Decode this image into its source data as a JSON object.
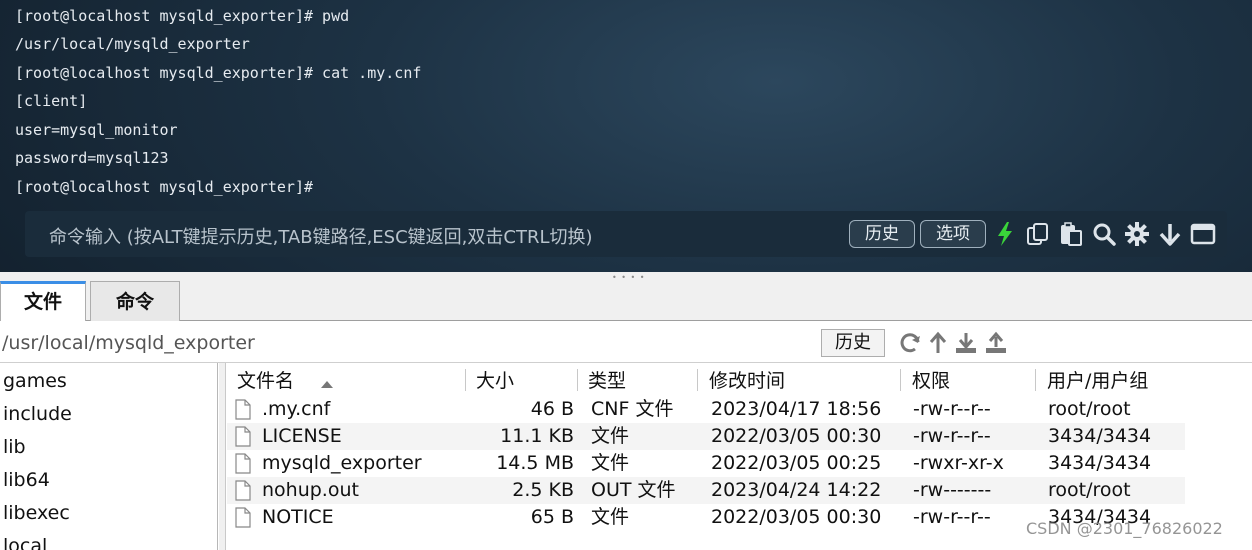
{
  "terminal": {
    "lines": [
      "[root@localhost mysqld_exporter]# pwd",
      "/usr/local/mysqld_exporter",
      "[root@localhost mysqld_exporter]# cat .my.cnf",
      "[client]",
      "user=mysql_monitor",
      "password=mysql123",
      "[root@localhost mysqld_exporter]#"
    ],
    "command_placeholder": "命令输入 (按ALT键提示历史,TAB键路径,ESC键返回,双击CTRL切换)",
    "history_button": "历史",
    "options_button": "选项",
    "toolbar_icons": [
      "lightning-icon",
      "copy-icon",
      "paste-icon",
      "search-icon",
      "gear-icon",
      "arrow-down-icon",
      "window-icon"
    ]
  },
  "splitter_grip": "• • • •",
  "tabs": [
    {
      "label": "文件",
      "active": true
    },
    {
      "label": "命令",
      "active": false
    }
  ],
  "path_bar": {
    "path": "/usr/local/mysqld_exporter",
    "history_button": "历史",
    "icons": [
      "refresh-icon",
      "up-arrow-icon",
      "download-icon",
      "upload-icon"
    ]
  },
  "tree": {
    "items": [
      "games",
      "include",
      "lib",
      "lib64",
      "libexec",
      "local"
    ]
  },
  "file_list": {
    "columns": [
      "文件名",
      "大小",
      "类型",
      "修改时间",
      "权限",
      "用户/用户组"
    ],
    "rows": [
      {
        "name": ".my.cnf",
        "size": "46 B",
        "type": "CNF 文件",
        "modified": "2023/04/17 18:56",
        "permissions": "-rw-r--r--",
        "owner": "root/root"
      },
      {
        "name": "LICENSE",
        "size": "11.1 KB",
        "type": "文件",
        "modified": "2022/03/05 00:30",
        "permissions": "-rw-r--r--",
        "owner": "3434/3434"
      },
      {
        "name": "mysqld_exporter",
        "size": "14.5 MB",
        "type": "文件",
        "modified": "2022/03/05 00:25",
        "permissions": "-rwxr-xr-x",
        "owner": "3434/3434"
      },
      {
        "name": "nohup.out",
        "size": "2.5 KB",
        "type": "OUT 文件",
        "modified": "2023/04/24 14:22",
        "permissions": "-rw-------",
        "owner": "root/root"
      },
      {
        "name": "NOTICE",
        "size": "65 B",
        "type": "文件",
        "modified": "2022/03/05 00:30",
        "permissions": "-rw-r--r--",
        "owner": "3434/3434"
      }
    ]
  },
  "watermark": "CSDN @2301_76826022",
  "colors": {
    "terminal_bg": "#1d3244",
    "lightning_accent": "#3ad43a",
    "active_tab_accent": "#3a8ee6"
  }
}
